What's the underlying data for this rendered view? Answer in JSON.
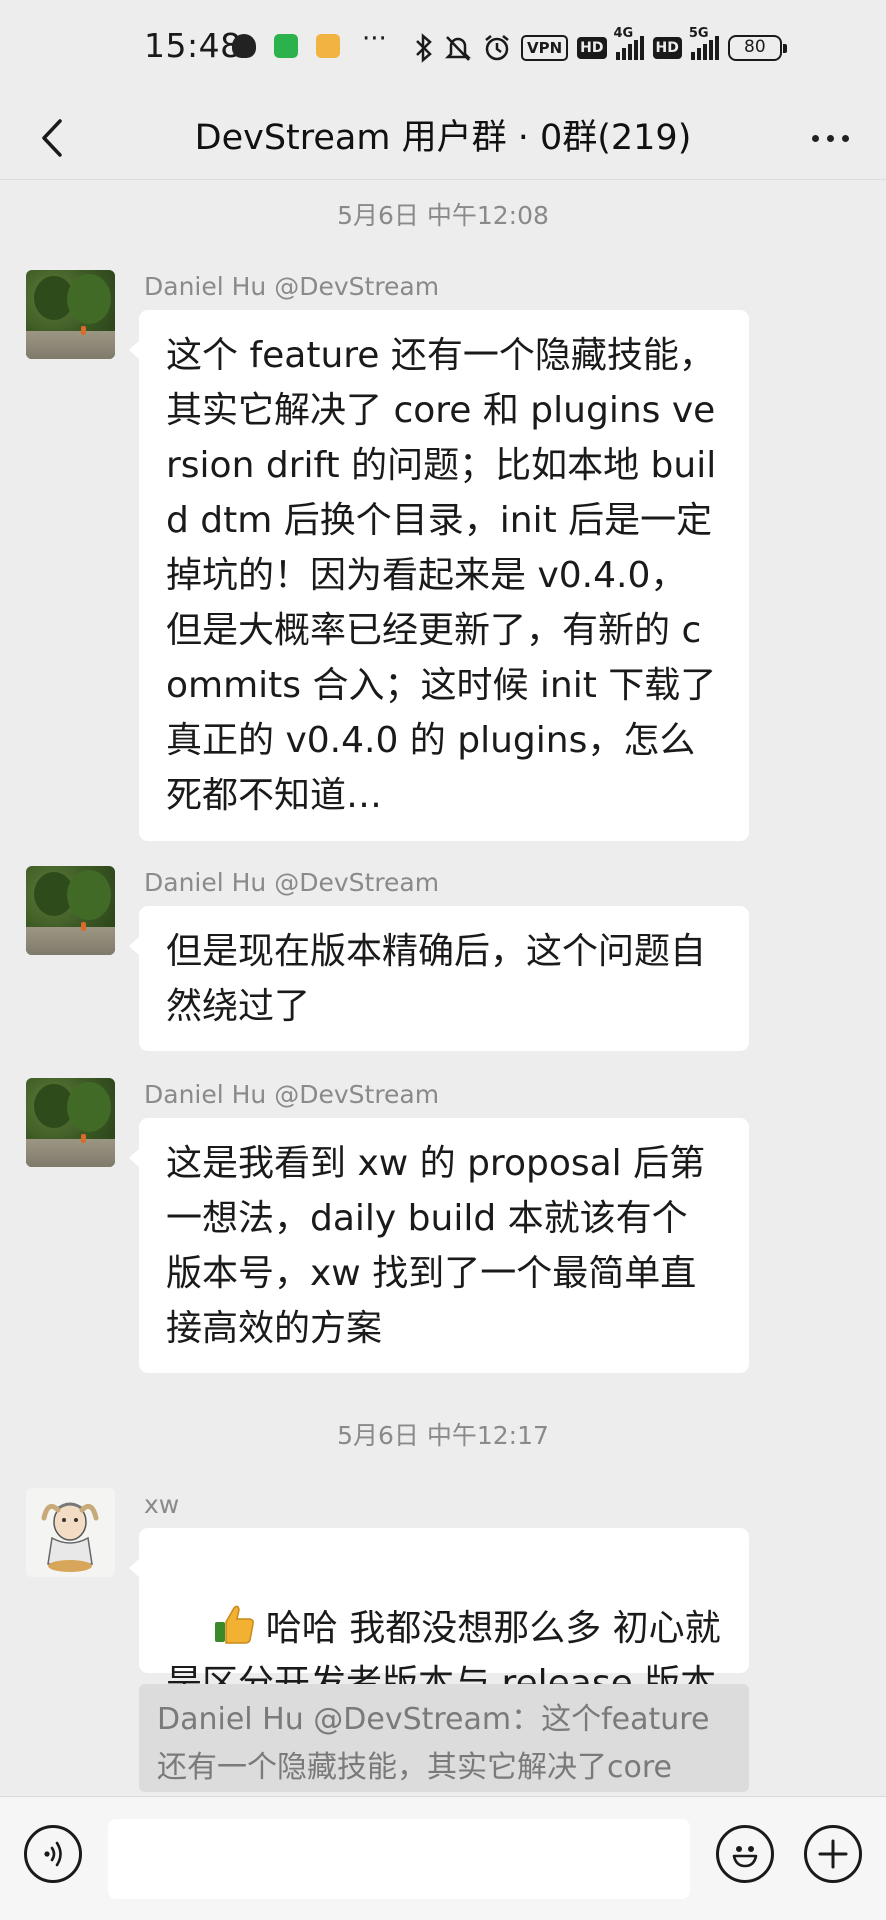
{
  "status_bar": {
    "time": "15:48",
    "vpn_label": "VPN",
    "hd_label_1": "HD",
    "network_1": "4G",
    "hd_label_2": "HD",
    "network_2": "5G",
    "battery": "80",
    "overflow": "···"
  },
  "nav": {
    "title": "DevStream 用户群 · 0群(219)"
  },
  "timestamps": [
    "5月6日 中午12:08",
    "5月6日 中午12:17"
  ],
  "messages": [
    {
      "sender": "Daniel Hu @DevStream",
      "text": "这个 feature 还有一个隐藏技能，其实它解决了 core 和 plugins version drift 的问题；比如本地 build dtm 后换个目录，init 后是一定掉坑的！因为看起来是 v0.4.0，但是大概率已经更新了，有新的 commits 合入；这时候 init 下载了真正的 v0.4.0 的 plugins，怎么死都不知道…"
    },
    {
      "sender": "Daniel Hu @DevStream",
      "text": "但是现在版本精确后，这个问题自然绕过了"
    },
    {
      "sender": "Daniel Hu @DevStream",
      "text": "这是我看到 xw 的 proposal 后第一想法，daily build 本就该有个版本号，xw 找到了一个最简单直接高效的方案"
    },
    {
      "sender": "xw",
      "emoji": "thumbs-up",
      "text": "哈哈 我都没想那么多 初心就是区分开发者版本与 release 版本",
      "quote": "Daniel Hu @DevStream：这个feature还有一个隐藏技能，其实它解决了core 和..."
    }
  ],
  "colors": {
    "background": "#ededed",
    "bubble": "#ffffff",
    "quote": "#dcdcdc",
    "secondary_text": "#8a8a8a"
  }
}
